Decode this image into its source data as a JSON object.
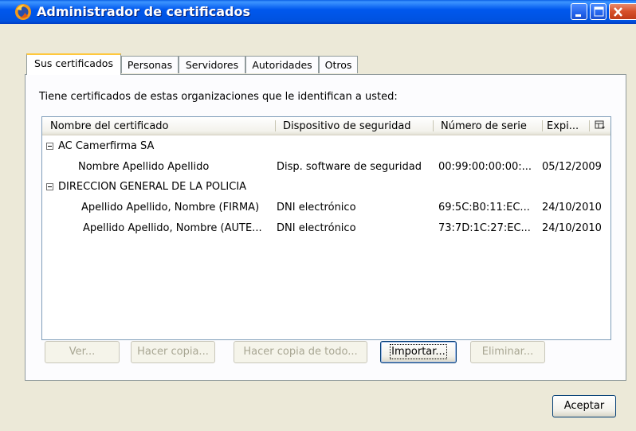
{
  "window": {
    "title": "Administrador de certificados"
  },
  "tabs": [
    {
      "label": "Sus certificados",
      "active": true
    },
    {
      "label": "Personas"
    },
    {
      "label": "Servidores"
    },
    {
      "label": "Autoridades"
    },
    {
      "label": "Otros"
    }
  ],
  "panel": {
    "intro": "Tiene certificados de estas organizaciones que le identifican a usted:",
    "columns": [
      "Nombre del certificado",
      "Dispositivo de seguridad",
      "Número de serie",
      "Expi..."
    ],
    "groups": [
      {
        "name": "AC Camerfirma SA"
      },
      {
        "name": "DIRECCION GENERAL DE LA POLICIA"
      }
    ],
    "rows": [
      {
        "name": "Nombre Apellido Apellido",
        "device": "Disp. software de seguridad",
        "serial": "00:99:00:00:00:...",
        "expires": "05/12/2009"
      },
      {
        "name": "Apellido Apellido, Nombre (FIRMA)",
        "device": "DNI electrónico",
        "serial": "69:5C:B0:11:EC...",
        "expires": "24/10/2010"
      },
      {
        "name": "Apellido Apellido, Nombre (AUTE...",
        "device": "DNI electrónico",
        "serial": "73:7D:1C:27:EC...",
        "expires": "24/10/2010"
      }
    ],
    "buttons": {
      "view": "Ver...",
      "backup": "Hacer copia...",
      "backup_all": "Hacer copia de todo...",
      "import": "Importar...",
      "delete": "Eliminar..."
    }
  },
  "footer": {
    "ok": "Aceptar"
  },
  "icons": {
    "app": "firefox-icon",
    "minimize": "minimize-icon",
    "maximize": "maximize-icon",
    "close": "close-icon",
    "column_picker": "column-picker-icon"
  },
  "colors": {
    "titlebar": "#0058ee",
    "window_bg": "#ece9d8",
    "active_tab_accent": "#ffc83c",
    "close_button": "#d6502a"
  }
}
